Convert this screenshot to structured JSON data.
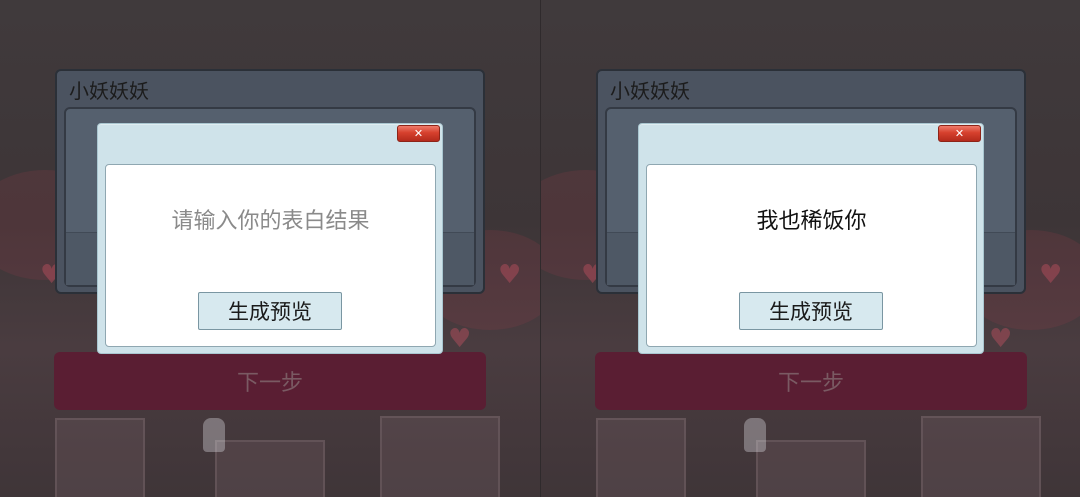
{
  "screens": [
    {
      "form": {
        "title": "小妖妖妖"
      },
      "next_button_label": "下一步",
      "dialog": {
        "close_label": "✕",
        "text": "请输入你的表白结果",
        "text_state": "placeholder",
        "generate_label": "生成预览"
      }
    },
    {
      "form": {
        "title": "小妖妖妖"
      },
      "next_button_label": "下一步",
      "dialog": {
        "close_label": "✕",
        "text": "我也稀饭你",
        "text_state": "filled",
        "generate_label": "生成预览"
      }
    }
  ],
  "colors": {
    "dialog_background": "#cfe3ea",
    "close_button": "#d6402d",
    "next_button": "#5a1e33",
    "form_panel": "#4b5360"
  }
}
